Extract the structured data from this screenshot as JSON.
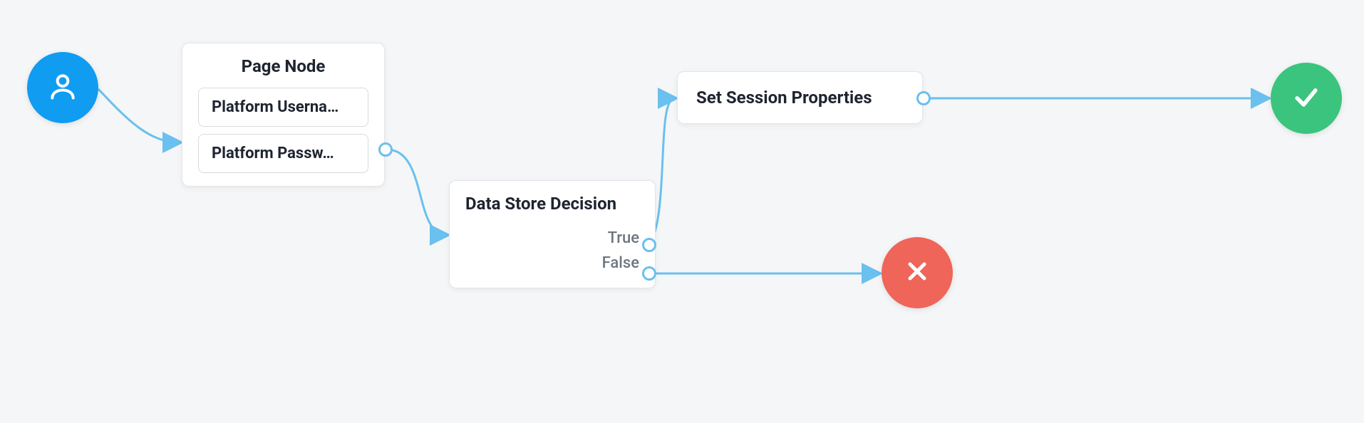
{
  "nodes": {
    "start": {
      "icon": "user-icon"
    },
    "page_node": {
      "title": "Page Node",
      "fields": [
        "Platform Userna…",
        "Platform Passw…"
      ]
    },
    "decision": {
      "title": "Data Store Decision",
      "outcomes": {
        "true": "True",
        "false": "False"
      }
    },
    "session": {
      "title": "Set Session Properties"
    },
    "success": {
      "icon": "check-icon"
    },
    "failure": {
      "icon": "cross-icon"
    }
  },
  "colors": {
    "start": "#109cf1",
    "success": "#3bc47d",
    "failure": "#ef6559",
    "connector": "#6ac0ee"
  }
}
